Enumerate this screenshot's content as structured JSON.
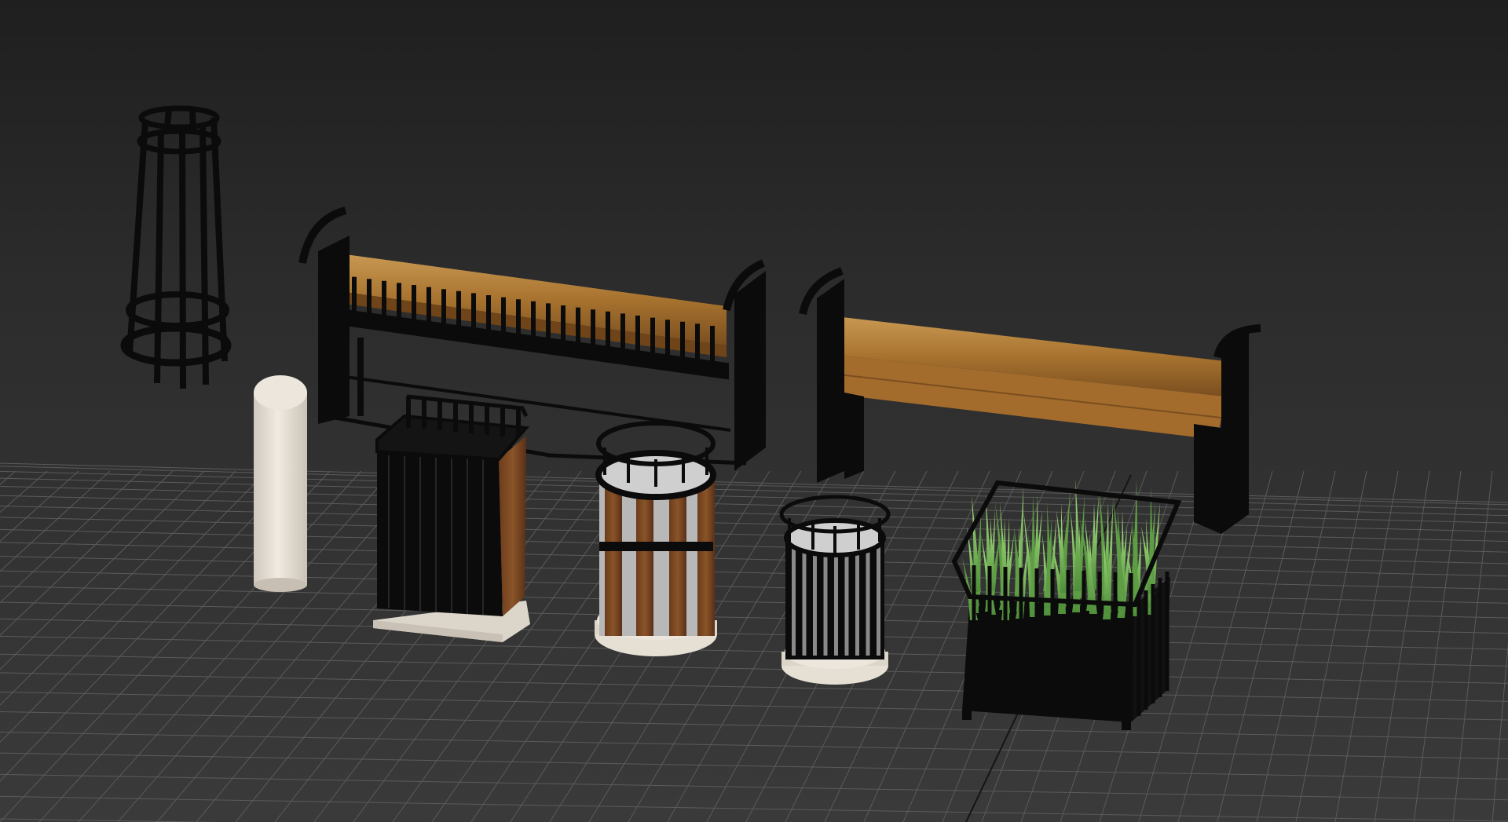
{
  "viewport": {
    "background_top": "#1f1f1f",
    "background_bottom": "#3a3a3a",
    "grid_color": "#5b5b5b",
    "axis_line_color": "#111111",
    "view": "perspective"
  },
  "objects": [
    {
      "name": "tree-guard",
      "material": "black-metal"
    },
    {
      "name": "bollard",
      "material": "white-marble"
    },
    {
      "name": "bench-with-back",
      "material": "wood-and-black-metal"
    },
    {
      "name": "bench-backless",
      "material": "wood-and-black-metal"
    },
    {
      "name": "square-trash-bin",
      "material": "black-metal-wood-marble-base"
    },
    {
      "name": "round-wood-trash-bin",
      "material": "wood-metal-marble-base"
    },
    {
      "name": "round-metal-trash-bin",
      "material": "black-metal-marble-base"
    },
    {
      "name": "planter-with-grass",
      "material": "black-metal-grass"
    }
  ],
  "colors": {
    "metal": "#0b0b0b",
    "wood_light": "#b8843f",
    "wood_dark": "#7a4e1f",
    "wood_brown": "#5a3018",
    "marble": "#e4ddd2",
    "marble_shadow": "#c9c1b5",
    "inner_gray": "#b9b9b9",
    "grass": "#8fd06b",
    "grass_dark": "#5f9d45"
  }
}
